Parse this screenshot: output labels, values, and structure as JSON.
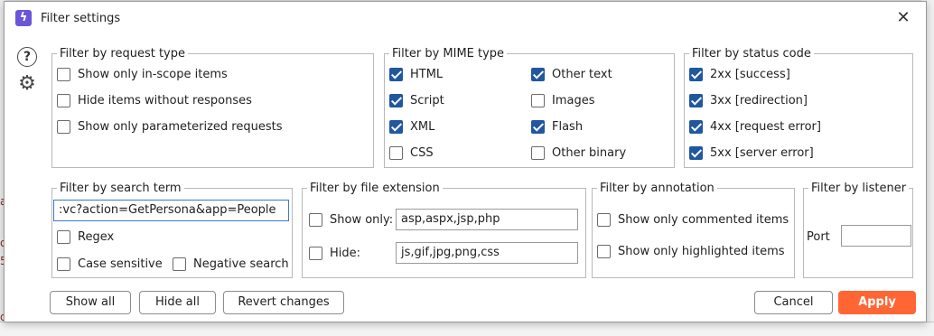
{
  "window": {
    "title": "Filter settings",
    "app_icon": "burp-lightning-icon"
  },
  "background": {
    "frag_a": "a",
    "frag_b": "o",
    "frag_c": "5",
    "frag_d": "d"
  },
  "request_type": {
    "legend": "Filter by request type",
    "items": [
      {
        "label": "Show only in-scope items",
        "checked": false
      },
      {
        "label": "Hide items without responses",
        "checked": false
      },
      {
        "label": "Show only parameterized requests",
        "checked": false
      }
    ]
  },
  "mime_type": {
    "legend": "Filter by MIME type",
    "items": [
      {
        "label": "HTML",
        "checked": true
      },
      {
        "label": "Script",
        "checked": true
      },
      {
        "label": "XML",
        "checked": true
      },
      {
        "label": "CSS",
        "checked": false
      },
      {
        "label": "Other text",
        "checked": true
      },
      {
        "label": "Images",
        "checked": false
      },
      {
        "label": "Flash",
        "checked": true
      },
      {
        "label": "Other binary",
        "checked": false
      }
    ]
  },
  "status_code": {
    "legend": "Filter by status code",
    "items": [
      {
        "label": "2xx  [success]",
        "checked": true
      },
      {
        "label": "3xx  [redirection]",
        "checked": true
      },
      {
        "label": "4xx  [request error]",
        "checked": true
      },
      {
        "label": "5xx  [server error]",
        "checked": true
      }
    ]
  },
  "search_term": {
    "legend": "Filter by search term",
    "value": ":vc?action=GetPersona&app=People",
    "regex_label": "Regex",
    "regex_checked": false,
    "case_label": "Case sensitive",
    "case_checked": false,
    "negative_label": "Negative search",
    "negative_checked": false
  },
  "file_extension": {
    "legend": "Filter by file extension",
    "show_only_label": "Show only:",
    "show_only_checked": false,
    "show_only_value": "asp,aspx,jsp,php",
    "hide_label": "Hide:",
    "hide_checked": false,
    "hide_value": "js,gif,jpg,png,css"
  },
  "annotation": {
    "legend": "Filter by annotation",
    "items": [
      {
        "label": "Show only commented items",
        "checked": false
      },
      {
        "label": "Show only highlighted items",
        "checked": false
      }
    ]
  },
  "listener": {
    "legend": "Filter by listener",
    "port_label": "Port",
    "port_value": ""
  },
  "buttons": {
    "show_all": "Show all",
    "hide_all": "Hide all",
    "revert": "Revert changes",
    "cancel": "Cancel",
    "apply": "Apply"
  },
  "colors": {
    "accent": "#ff6633",
    "checkbox": "#20579f"
  }
}
